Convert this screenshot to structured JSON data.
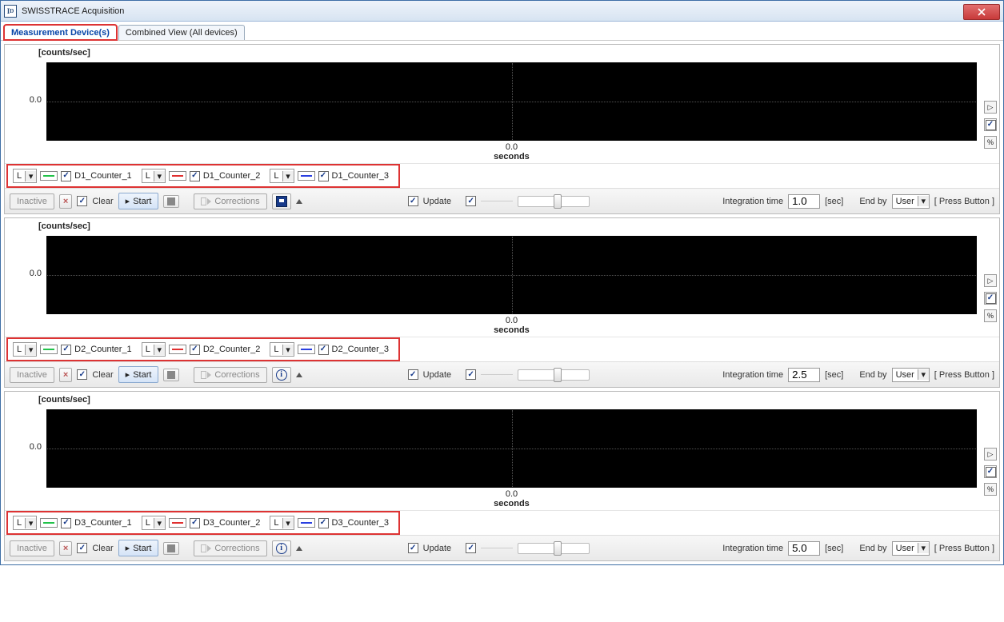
{
  "window": {
    "title": "SWISSTRACE Acquisition"
  },
  "tabs": [
    {
      "label": "Measurement Device(s)",
      "active": true,
      "highlighted": true
    },
    {
      "label": "Combined View (All devices)",
      "active": false,
      "highlighted": false
    }
  ],
  "common": {
    "ylabel": "[counts/sec]",
    "ytick": "0.0",
    "xtick": "0.0",
    "xlabel": "seconds",
    "linetype_letter": "L",
    "counter_colors": {
      "c1": "#22c24a",
      "c2": "#e03030",
      "c3": "#2a3fe0"
    },
    "buttons": {
      "inactive": "Inactive",
      "clear": "Clear",
      "start": "Start",
      "corrections": "Corrections",
      "update": "Update",
      "integration_time": "Integration time",
      "sec_unit": "[sec]",
      "end_by": "End by",
      "end_by_value": "User",
      "press_button": "[ Press Button ]"
    },
    "side": {
      "scroll": "▷",
      "check": "✓",
      "percent": "%"
    }
  },
  "devices": [
    {
      "id": "D1",
      "counters": [
        "D1_Counter_1",
        "D1_Counter_2",
        "D1_Counter_3"
      ],
      "integration_time": "1.0",
      "action_icon": "save"
    },
    {
      "id": "D2",
      "counters": [
        "D2_Counter_1",
        "D2_Counter_2",
        "D2_Counter_3"
      ],
      "integration_time": "2.5",
      "action_icon": "info"
    },
    {
      "id": "D3",
      "counters": [
        "D3_Counter_1",
        "D3_Counter_2",
        "D3_Counter_3"
      ],
      "integration_time": "5.0",
      "action_icon": "info"
    }
  ],
  "chart_data": [
    {
      "type": "line",
      "title": "D1",
      "xlabel": "seconds",
      "ylabel": "[counts/sec]",
      "xlim": [
        0,
        0
      ],
      "ylim": [
        0,
        0
      ],
      "series": [
        {
          "name": "D1_Counter_1",
          "values": []
        },
        {
          "name": "D1_Counter_2",
          "values": []
        },
        {
          "name": "D1_Counter_3",
          "values": []
        }
      ]
    },
    {
      "type": "line",
      "title": "D2",
      "xlabel": "seconds",
      "ylabel": "[counts/sec]",
      "xlim": [
        0,
        0
      ],
      "ylim": [
        0,
        0
      ],
      "series": [
        {
          "name": "D2_Counter_1",
          "values": []
        },
        {
          "name": "D2_Counter_2",
          "values": []
        },
        {
          "name": "D2_Counter_3",
          "values": []
        }
      ]
    },
    {
      "type": "line",
      "title": "D3",
      "xlabel": "seconds",
      "ylabel": "[counts/sec]",
      "xlim": [
        0,
        0
      ],
      "ylim": [
        0,
        0
      ],
      "series": [
        {
          "name": "D3_Counter_1",
          "values": []
        },
        {
          "name": "D3_Counter_2",
          "values": []
        },
        {
          "name": "D3_Counter_3",
          "values": []
        }
      ]
    }
  ]
}
